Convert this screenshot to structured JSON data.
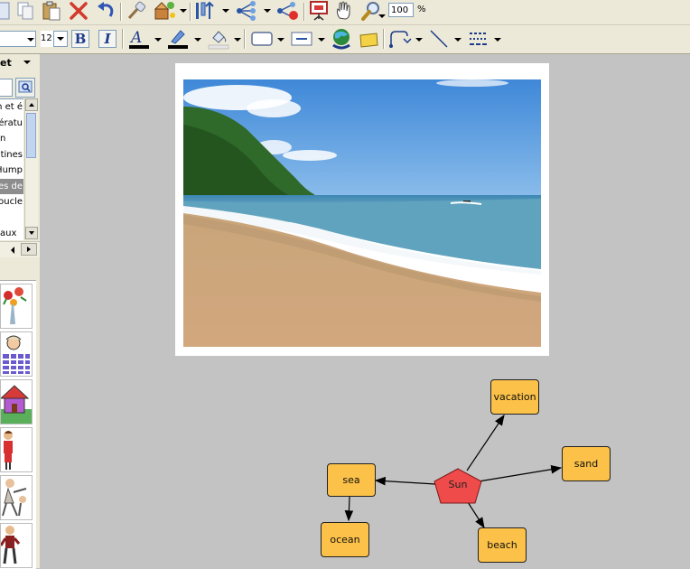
{
  "toolbar": {
    "zoom_value": "100",
    "zoom_unit": "%",
    "font_size": "12",
    "bold_label": "B",
    "italic_label": "I",
    "font_color": "#000000",
    "highlight_color": "#000000"
  },
  "sidebar": {
    "title": "et",
    "items": [
      "n et é",
      "ératu",
      "n",
      "otines",
      "Hump",
      "es de",
      "Boucle",
      "",
      "aux"
    ],
    "selected_index": 5
  },
  "mindmap": {
    "center": "Sun",
    "nodes": {
      "vacation": "vacation",
      "sand": "sand",
      "beach": "beach",
      "sea": "sea",
      "ocean": "ocean"
    },
    "node_color": "#fbc148",
    "center_color": "#f04b4b"
  }
}
